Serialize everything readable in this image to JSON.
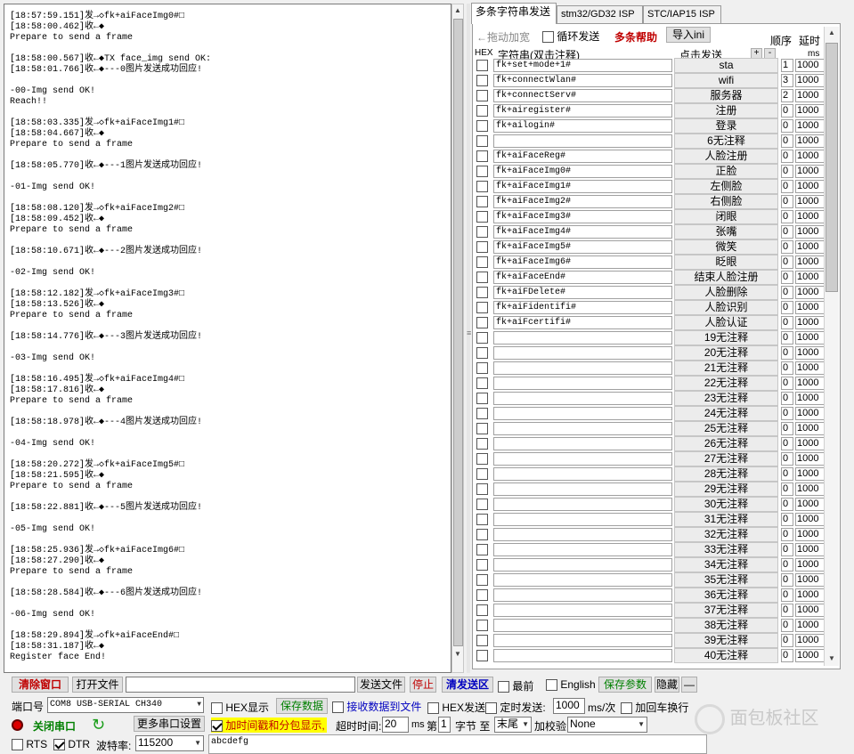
{
  "log": {
    "lines": [
      "[18:57:59.151]发→◇fk+aiFaceImg0#□",
      "[18:58:00.462]收←◆",
      "Prepare to send a frame",
      "",
      "[18:58:00.567]收←◆TX face_img send OK:",
      "[18:58:01.766]收←◆---0图片发送成功回应!",
      "",
      "-00-Img send OK!",
      "Reach!!",
      "",
      "[18:58:03.335]发→◇fk+aiFaceImg1#□",
      "[18:58:04.667]收←◆",
      "Prepare to send a frame",
      "",
      "[18:58:05.770]收←◆---1图片发送成功回应!",
      "",
      "-01-Img send OK!",
      "",
      "[18:58:08.120]发→◇fk+aiFaceImg2#□",
      "[18:58:09.452]收←◆",
      "Prepare to send a frame",
      "",
      "[18:58:10.671]收←◆---2图片发送成功回应!",
      "",
      "-02-Img send OK!",
      "",
      "[18:58:12.182]发→◇fk+aiFaceImg3#□",
      "[18:58:13.526]收←◆",
      "Prepare to send a frame",
      "",
      "[18:58:14.776]收←◆---3图片发送成功回应!",
      "",
      "-03-Img send OK!",
      "",
      "[18:58:16.495]发→◇fk+aiFaceImg4#□",
      "[18:58:17.816]收←◆",
      "Prepare to send a frame",
      "",
      "[18:58:18.978]收←◆---4图片发送成功回应!",
      "",
      "-04-Img send OK!",
      "",
      "[18:58:20.272]发→◇fk+aiFaceImg5#□",
      "[18:58:21.595]收←◆",
      "Prepare to send a frame",
      "",
      "[18:58:22.881]收←◆---5图片发送成功回应!",
      "",
      "-05-Img send OK!",
      "",
      "[18:58:25.936]发→◇fk+aiFaceImg6#□",
      "[18:58:27.290]收←◆",
      "Prepare to send a frame",
      "",
      "[18:58:28.584]收←◆---6图片发送成功回应!",
      "",
      "-06-Img send OK!",
      "",
      "[18:58:29.894]发→◇fk+aiFaceEnd#□",
      "[18:58:31.187]收←◆",
      "Register face End!"
    ]
  },
  "tabs": [
    "多条字符串发送",
    "stm32/GD32 ISP",
    "STC/IAP15 ISP"
  ],
  "multi": {
    "drag_label": "←拖动加宽",
    "loop_label": "循环发送",
    "help_label": "多条帮助",
    "import_label": "导入ini",
    "order_label": "顺序",
    "delay_label": "延时",
    "hex_label": "HEX",
    "string_label": "字符串(双击注释)",
    "click_label": "点击发送",
    "plus": "+",
    "minus": "-",
    "ms_label": "ms",
    "rows": [
      {
        "str": "fk+set+mode+1#",
        "btn": "sta",
        "ord": "1",
        "dly": "1000"
      },
      {
        "str": "fk+connectWlan#",
        "btn": "wifi",
        "ord": "3",
        "dly": "1000"
      },
      {
        "str": "fk+connectServ#",
        "btn": "服务器",
        "ord": "2",
        "dly": "1000"
      },
      {
        "str": "fk+airegister#",
        "btn": "注册",
        "ord": "0",
        "dly": "1000"
      },
      {
        "str": "fk+ailogin#",
        "btn": "登录",
        "ord": "0",
        "dly": "1000"
      },
      {
        "str": "",
        "btn": "6无注释",
        "ord": "0",
        "dly": "1000"
      },
      {
        "str": "fk+aiFaceReg#",
        "btn": "人脸注册",
        "ord": "0",
        "dly": "1000"
      },
      {
        "str": "fk+aiFaceImg0#",
        "btn": "正脸",
        "ord": "0",
        "dly": "1000"
      },
      {
        "str": "fk+aiFaceImg1#",
        "btn": "左侧脸",
        "ord": "0",
        "dly": "1000"
      },
      {
        "str": "fk+aiFaceImg2#",
        "btn": "右侧脸",
        "ord": "0",
        "dly": "1000"
      },
      {
        "str": "fk+aiFaceImg3#",
        "btn": "闭眼",
        "ord": "0",
        "dly": "1000"
      },
      {
        "str": "fk+aiFaceImg4#",
        "btn": "张嘴",
        "ord": "0",
        "dly": "1000"
      },
      {
        "str": "fk+aiFaceImg5#",
        "btn": "微笑",
        "ord": "0",
        "dly": "1000"
      },
      {
        "str": "fk+aiFaceImg6#",
        "btn": "眨眼",
        "ord": "0",
        "dly": "1000"
      },
      {
        "str": "fk+aiFaceEnd#",
        "btn": "结束人脸注册",
        "ord": "0",
        "dly": "1000"
      },
      {
        "str": "fk+aiFDelete#",
        "btn": "人脸删除",
        "ord": "0",
        "dly": "1000"
      },
      {
        "str": "fk+aiFidentifi#",
        "btn": "人脸识别",
        "ord": "0",
        "dly": "1000"
      },
      {
        "str": "fk+aiFcertifi#",
        "btn": "人脸认证",
        "ord": "0",
        "dly": "1000"
      },
      {
        "str": "",
        "btn": "19无注释",
        "ord": "0",
        "dly": "1000"
      },
      {
        "str": "",
        "btn": "20无注释",
        "ord": "0",
        "dly": "1000"
      },
      {
        "str": "",
        "btn": "21无注释",
        "ord": "0",
        "dly": "1000"
      },
      {
        "str": "",
        "btn": "22无注释",
        "ord": "0",
        "dly": "1000"
      },
      {
        "str": "",
        "btn": "23无注释",
        "ord": "0",
        "dly": "1000"
      },
      {
        "str": "",
        "btn": "24无注释",
        "ord": "0",
        "dly": "1000"
      },
      {
        "str": "",
        "btn": "25无注释",
        "ord": "0",
        "dly": "1000"
      },
      {
        "str": "",
        "btn": "26无注释",
        "ord": "0",
        "dly": "1000"
      },
      {
        "str": "",
        "btn": "27无注释",
        "ord": "0",
        "dly": "1000"
      },
      {
        "str": "",
        "btn": "28无注释",
        "ord": "0",
        "dly": "1000"
      },
      {
        "str": "",
        "btn": "29无注释",
        "ord": "0",
        "dly": "1000"
      },
      {
        "str": "",
        "btn": "30无注释",
        "ord": "0",
        "dly": "1000"
      },
      {
        "str": "",
        "btn": "31无注释",
        "ord": "0",
        "dly": "1000"
      },
      {
        "str": "",
        "btn": "32无注释",
        "ord": "0",
        "dly": "1000"
      },
      {
        "str": "",
        "btn": "33无注释",
        "ord": "0",
        "dly": "1000"
      },
      {
        "str": "",
        "btn": "34无注释",
        "ord": "0",
        "dly": "1000"
      },
      {
        "str": "",
        "btn": "35无注释",
        "ord": "0",
        "dly": "1000"
      },
      {
        "str": "",
        "btn": "36无注释",
        "ord": "0",
        "dly": "1000"
      },
      {
        "str": "",
        "btn": "37无注释",
        "ord": "0",
        "dly": "1000"
      },
      {
        "str": "",
        "btn": "38无注释",
        "ord": "0",
        "dly": "1000"
      },
      {
        "str": "",
        "btn": "39无注释",
        "ord": "0",
        "dly": "1000"
      },
      {
        "str": "",
        "btn": "40无注释",
        "ord": "0",
        "dly": "1000"
      }
    ]
  },
  "bottom": {
    "clear_window": "清除窗口",
    "open_file": "打开文件",
    "send_file": "发送文件",
    "stop": "停止",
    "clear_send": "清发送区",
    "topmost": "最前",
    "english": "English",
    "save_params": "保存参数",
    "hide": "隐藏",
    "dash": "—",
    "port_label": "端口号",
    "port_value": "COM8 USB-SERIAL CH340",
    "hex_display": "HEX显示",
    "save_data": "保存数据",
    "recv_to_file": "接收数据到文件",
    "hex_send": "HEX发送",
    "timed_send": "定时发送:",
    "timed_value": "1000",
    "ms_per": "ms/次",
    "add_crlf": "加回车换行",
    "close_port": "关闭串口",
    "more_settings": "更多串口设置",
    "timestamp_label": "加时间戳和分包显示,",
    "timeout_label": "超时时间:",
    "timeout_value": "20",
    "ms": "ms",
    "nth_label": "第",
    "nth_value": "1",
    "byte_label": "字节 至",
    "end_value": "末尾",
    "checksum_label": "加校验",
    "checksum_value": "None",
    "rts": "RTS",
    "dtr": "DTR",
    "baud_label": "波特率:",
    "baud_value": "115200",
    "send_text": "abcdefg"
  },
  "watermark": "面包板社区",
  "colors": {
    "accent_red": "#c00000",
    "accent_green": "#008000"
  }
}
